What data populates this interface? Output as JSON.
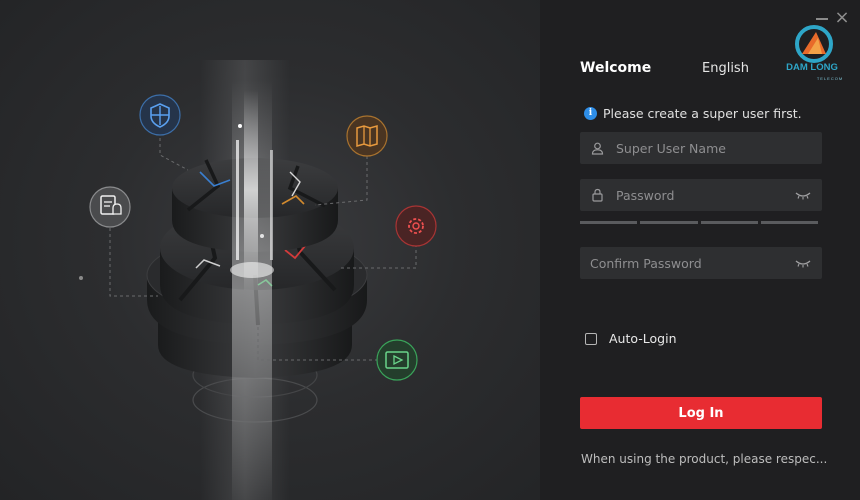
{
  "header": {
    "title": "Welcome",
    "language": "English",
    "logo_text": "DAM LONG",
    "logo_subtext": "TELECOM",
    "close_symbol": "×"
  },
  "notice": {
    "icon": "info-icon",
    "text": "Please create a super user first."
  },
  "form": {
    "username": {
      "placeholder": "Super User Name",
      "value": "",
      "icon": "user-icon"
    },
    "password": {
      "placeholder": "Password",
      "value": "",
      "icon": "lock-icon",
      "toggle_icon": "eye-closed-icon"
    },
    "strength_meter": {
      "segments": 4,
      "level": 0
    },
    "confirm_password": {
      "placeholder": "Confirm Password",
      "value": "",
      "toggle_icon": "eye-closed-icon"
    },
    "auto_login": {
      "label": "Auto-Login",
      "checked": false
    },
    "submit_label": "Log In"
  },
  "footer": {
    "text": "When using the product, please respec..."
  },
  "illustration": {
    "icons": [
      "shield-icon",
      "map-icon",
      "document-bell-icon",
      "gear-icon",
      "video-icon"
    ]
  },
  "colors": {
    "accent": "#e82c32",
    "info": "#2e8ee8",
    "panel_background": "#1f1f21",
    "field_background": "#2e2f31"
  }
}
